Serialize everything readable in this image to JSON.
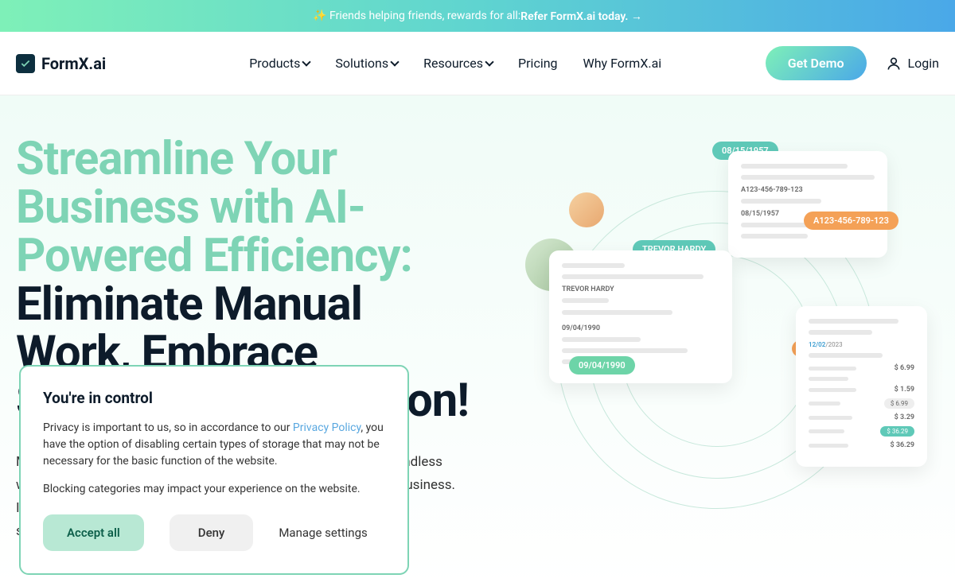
{
  "announcement": {
    "prefix": "✨ Friends helping friends, rewards for all: ",
    "link": "Refer FormX.ai today. →"
  },
  "logo": "FormX.ai",
  "nav": {
    "products": "Products",
    "solutions": "Solutions",
    "resources": "Resources",
    "pricing": "Pricing",
    "why": "Why FormX.ai"
  },
  "cta": {
    "demo": "Get Demo",
    "login": "Login"
  },
  "hero": {
    "title_green": "Streamline Your Business with AI-Powered Efficiency:",
    "title_dark": " Eliminate Manual Work, Embrace Seamless Automation!",
    "desc": "Manual data capture, entry, and document processing is easy, mindless work—yet tedious, time-consuming, and a daunting task for any business. Integrate document processing with our data extraction API for a streamlined workflow."
  },
  "cards": {
    "date1": "08/15/1957",
    "id1": "A123-456-789-123",
    "id1_big": "A123-456-789-123",
    "date1b": "08/15/1957",
    "name": "TREVOR HARDY",
    "name_small": "TREVOR HARDY",
    "dob": "09/04/1990",
    "dob_big": "09/04/1990",
    "invoice_date_pill": "12/02/2023",
    "invoice_date": "12/02/2023",
    "prices": [
      "$ 6.99",
      "$ 1.59",
      "$ 6.99",
      "$ 3.29",
      "$ 36.29",
      "$ 36.29"
    ],
    "price_pill": "$ 36.29"
  },
  "cookie": {
    "title": "You're in control",
    "text_prefix": "Privacy is important to us, so in accordance to our ",
    "policy_link": "Privacy Policy",
    "text_suffix": ", you have the option of disabling certain types of storage that may not be necessary for the basic function of the website.",
    "text2": "Blocking categories may impact your experience on the website.",
    "accept": "Accept all",
    "deny": "Deny",
    "manage": "Manage settings"
  }
}
